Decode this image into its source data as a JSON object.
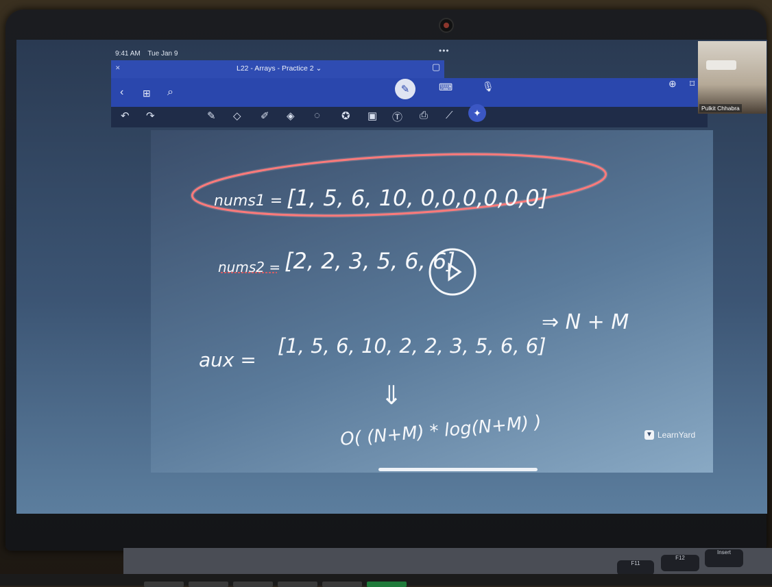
{
  "status": {
    "time": "9:41 AM",
    "date": "Tue Jan 9"
  },
  "document": {
    "title": "L22 - Arrays - Practice 2",
    "dropdown_icon": "chevron-down-icon"
  },
  "window": {
    "more_dots": "•••"
  },
  "nav": {
    "back_icon": "chevron-left-icon",
    "grid_icon": "grid-icon",
    "search_icon": "search-icon"
  },
  "modes": {
    "pen_icon": "pen-icon",
    "keyboard_icon": "keyboard-icon",
    "mic_icon": "microphone-icon"
  },
  "toolbar": {
    "undo_icon": "undo-icon",
    "redo_icon": "redo-icon",
    "tools": [
      "pen-icon",
      "eraser-icon",
      "highlighter-icon",
      "shapes-icon",
      "lasso-icon",
      "sticker-icon",
      "image-icon",
      "text-icon",
      "camera-icon",
      "ruler-icon",
      "laser-icon"
    ]
  },
  "whiteboard": {
    "line1_label": "nums1 =",
    "line1_values": "[1, 5, 6, 10, 0,0,0,0,0,0]",
    "line2_label": "nums2 =",
    "line2_values": "[2, 2, 3, 5, 6, 6]",
    "line3_label": "aux =",
    "line3_values": "[1, 5, 6, 10, 2, 2, 3, 5, 6, 6]",
    "line3_result": "⇒ N + M",
    "line4_arrow": "⇓",
    "line4_complexity": "O( (N+M) * log(N+M) )"
  },
  "watermark": {
    "brand": "LearnYard"
  },
  "video_feed": {
    "participant_name": "Pulkit Chhabra"
  },
  "keys": {
    "f11": "F11",
    "f12": "F12",
    "insert": "Insert"
  },
  "colors": {
    "toolbar_blue": "#2a47ad",
    "circle_red": "#ff5a5a",
    "ink_white": "#f6f8fb"
  }
}
